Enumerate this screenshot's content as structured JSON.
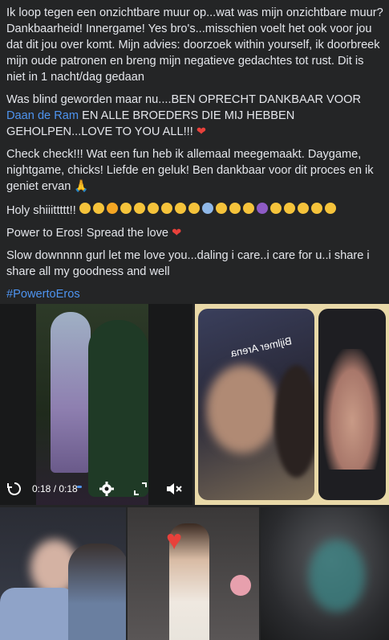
{
  "post": {
    "p1": "Ik loop tegen een onzichtbare muur op...wat was mijn onzichtbare muur? Dankbaarheid! Innergame! Yes bro's...misschien voelt het ook voor jou dat dit jou over komt. Mijn advies: doorzoek within yourself, ik doorbreek mijn oude patronen en breng mijn negatieve gedachtes tot rust. Dit is niet in 1 nacht/dag gedaan",
    "p2_before": "Was blind geworden maar nu....BEN OPRECHT DANKBAAR VOOR ",
    "p2_link": "Daan de Ram",
    "p2_after": " EN ALLE BROEDERS DIE MIJ HEBBEN GEHOLPEN...LOVE TO YOU ALL!!!",
    "p3": "Check check!!! Wat een fun heb ik allemaal meegemaakt. Daygame, nightgame, chicks! Liefde en geluk! Ben dankbaar voor dit proces en ik geniet ervan",
    "p4": "Holy shiiittttt!!",
    "p5": "Power to Eros! Spread the love",
    "p6": "Slow downnnn gurl let me love you...daling i care..i care for u..i share i share all my goodness and well",
    "hashtag": "#PowertoEros"
  },
  "video": {
    "time": "0:18 / 0:18",
    "icons": [
      "replay-icon",
      "settings-icon",
      "fullscreen-icon",
      "mute-icon"
    ]
  },
  "photo_text": {
    "sign": "Bijlmer Arena"
  },
  "colors": {
    "background": "#242526",
    "text": "#e4e6eb",
    "link": "#4e94f0",
    "heart": "#e8413b"
  }
}
